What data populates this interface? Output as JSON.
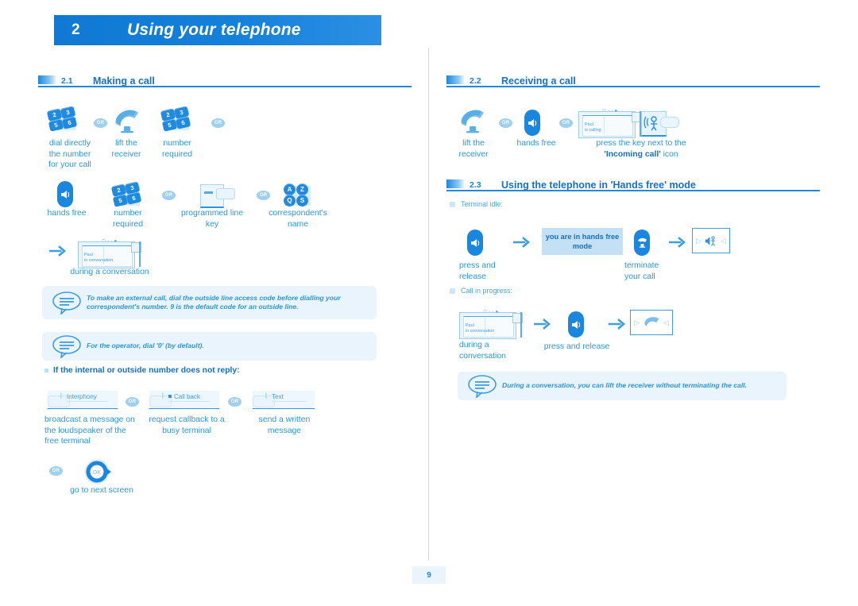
{
  "chapter": {
    "number": "2",
    "title": "Using your telephone"
  },
  "page_number": "9",
  "sections": {
    "making_a_call": {
      "number": "2.1",
      "title": "Making a call",
      "or_label": "OR",
      "row1": {
        "keypad_keys": [
          "2",
          "3",
          "5",
          "6"
        ],
        "caption_dial": "dial directly\nthe number\nfor your call",
        "caption_lift": "lift the\nreceiver",
        "caption_number": "number\nrequired"
      },
      "row2": {
        "caption_handsfree": "hands free",
        "caption_number": "number\nrequired",
        "caption_programmed": "programmed line\nkey",
        "caption_name": "correspondent's\nname",
        "alpha_keys": [
          "A",
          "Z",
          "Q",
          "S"
        ]
      },
      "row3": {
        "screen_line1": "Paul",
        "screen_line2": "in conversation",
        "caption": "during a conversation"
      },
      "note1": "To make an external call, dial the outside line access code before dialling your correspondent's number. 9 is the default code for an outside line.",
      "note2": "For the operator, dial '0' (by default).",
      "no_reply_heading": "If the internal or outside number does not reply:",
      "softkeys": [
        {
          "label": "Interphony",
          "caption": "broadcast a message on\nthe loudspeaker of the\nfree terminal"
        },
        {
          "label": "Call back",
          "caption": "request callback to a\nbusy terminal"
        },
        {
          "label": "Text",
          "caption": "send a written\nmessage"
        }
      ],
      "next_screen_caption": "go to next screen"
    },
    "receiving_a_call": {
      "number": "2.2",
      "title": "Receiving a call",
      "or_label": "OR",
      "caption_lift": "lift the\nreceiver",
      "caption_handsfree": "hands free",
      "screen_line1": "Paul",
      "screen_line2": "is calling",
      "caption_press_key_plain": "press the key next to the",
      "caption_press_key_bold": "'Incoming call'",
      "caption_press_key_tail": " icon"
    },
    "hands_free_mode": {
      "number": "2.3",
      "title": "Using the telephone in 'Hands free' mode",
      "terminal_idle_label": "Terminal idle:",
      "call_in_progress_label": "Call in progress:",
      "idle_flow": {
        "caption_press": "press and\nrelease",
        "highlight_text": "you are in hands free\nmode",
        "caption_terminate": "terminate\nyour call"
      },
      "progress_flow": {
        "screen_line1": "Paul",
        "screen_line2": "in conversation",
        "caption_during": "during a\nconversation",
        "caption_press": "press and release"
      },
      "note": "During a conversation, you can lift the receiver without terminating the call."
    }
  },
  "colors": {
    "brand_blue": "#1b86dd",
    "header_blue": "#1479d0",
    "text_blue": "#2a96e0",
    "note_bg": "#e9f4fc",
    "highlight_bg": "#c3e0f4"
  }
}
